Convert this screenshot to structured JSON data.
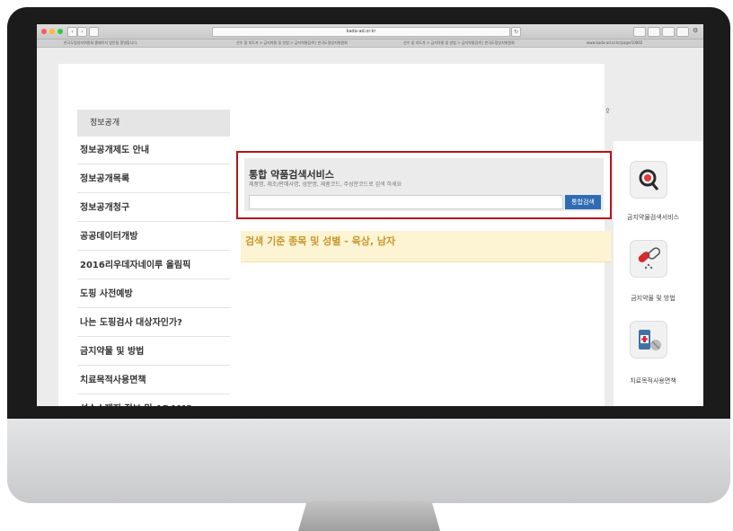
{
  "browser": {
    "url": "kada-ad.or.kr",
    "tabs": [
      "한국도핑방지위원회 홈페이지 방문을 환영합니다.",
      "선수 및 지도자 > 금지약물 및 방법 > 금지약물검색 | 한국도핑방지위원회",
      "선수 및 지도자 > 금지약물 및 방법 > 금지약물검색 | 한국도핑방지위원회",
      "www.kada-ad.or.kr/page/10802"
    ]
  },
  "header": {
    "share_icon": "share-icon"
  },
  "sidebar": {
    "title": "정보공개",
    "items": [
      {
        "label": "정보공개제도 안내"
      },
      {
        "label": "정보공개목록"
      },
      {
        "label": "정보공개청구"
      },
      {
        "label": "공공데이터개방"
      },
      {
        "label": "2016리우데자네이루 올림픽"
      },
      {
        "label": "도핑 사전예방"
      },
      {
        "label": "나는 도핑검사 대상자인가?"
      },
      {
        "label": "금지약물 및 방법"
      },
      {
        "label": "치료목적사용면책"
      },
      {
        "label": "선수소재지 정보 및 ADAMS"
      }
    ]
  },
  "search": {
    "title": "통합 약품검색서비스",
    "description": "제품명, 제조/판매사명, 성분명, 제품코드, 주성분코드로 검색 하세요",
    "input_value": "",
    "button_label": "통합검색"
  },
  "result": {
    "text": "검색 기준 종목 및 성별 - 육상, 남자"
  },
  "quicklinks": [
    {
      "label": "금지약물검색서비스",
      "icon": "magnifier-icon"
    },
    {
      "label": "금지약물 및 방법",
      "icon": "pills-icon"
    },
    {
      "label": "치료목적사용면책",
      "icon": "medicine-bottle-icon"
    }
  ],
  "colors": {
    "highlight_border": "#b4151d",
    "button": "#2f6bb3",
    "result_text": "#c8962e"
  }
}
